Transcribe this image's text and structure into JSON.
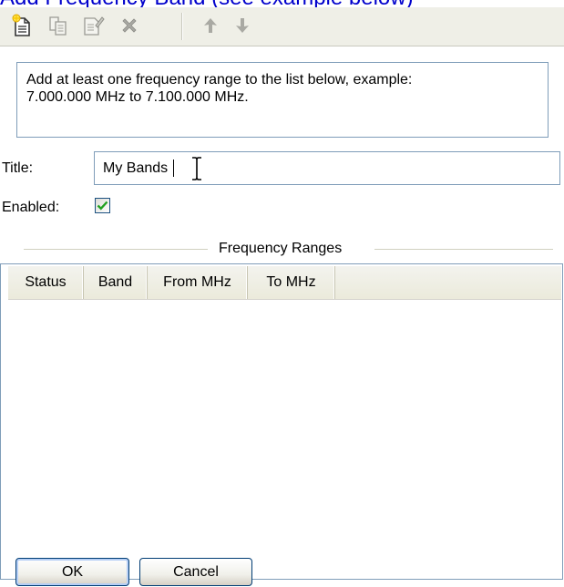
{
  "header_text": "Add Frequency Band (see example below)",
  "toolbar": {
    "buttons": [
      {
        "name": "new-icon"
      },
      {
        "name": "copy-icon"
      },
      {
        "name": "properties-icon"
      },
      {
        "name": "delete-icon"
      },
      {
        "name": "move-up-icon"
      },
      {
        "name": "move-down-icon"
      }
    ]
  },
  "info_text": "Add at least one frequency range to the list below, example:\n7.000.000 MHz to 7.100.000 MHz.",
  "title_field": {
    "label": "Title:",
    "value": "My Bands"
  },
  "enabled_field": {
    "label": "Enabled:",
    "checked": true
  },
  "group_title": "Frequency Ranges",
  "list": {
    "columns": [
      "Status",
      "Band",
      "From MHz",
      "To MHz"
    ],
    "rows": []
  },
  "buttons": {
    "ok": "OK",
    "cancel": "Cancel"
  },
  "colors": {
    "toolbar_bg": "#efefe7",
    "border": "#7f9db9",
    "check_green": "#21a121",
    "header_text": "#0000cc"
  }
}
